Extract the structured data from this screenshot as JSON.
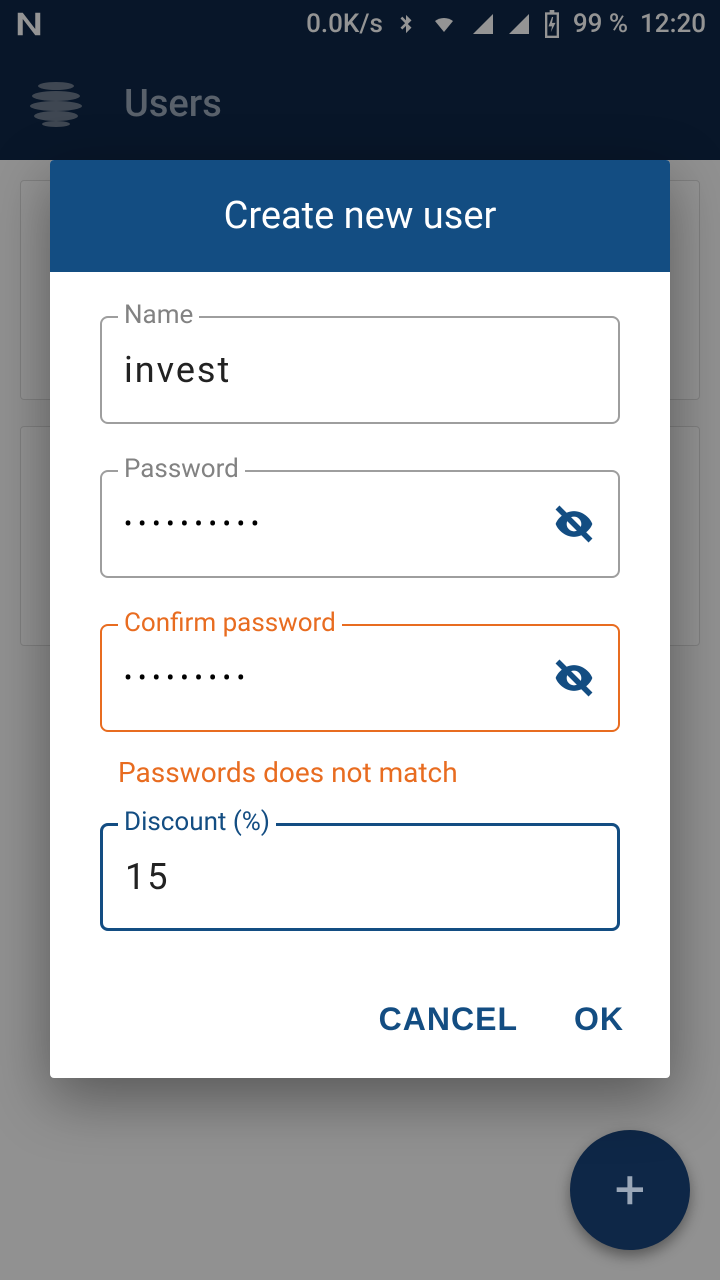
{
  "statusbar": {
    "speed": "0.0K/s",
    "battery_pct": "99 %",
    "time": "12:20"
  },
  "appbar": {
    "title": "Users"
  },
  "dialog": {
    "title": "Create new user",
    "name": {
      "label": "Name",
      "value": "invest"
    },
    "password": {
      "label": "Password",
      "value": "••••••••••"
    },
    "confirm": {
      "label": "Confirm password",
      "value": "•••••••••",
      "error": "Passwords does not match"
    },
    "discount": {
      "label": "Discount (%)",
      "value": "15"
    },
    "actions": {
      "cancel": "CANCEL",
      "ok": "OK"
    }
  },
  "fab": {
    "icon": "+"
  }
}
